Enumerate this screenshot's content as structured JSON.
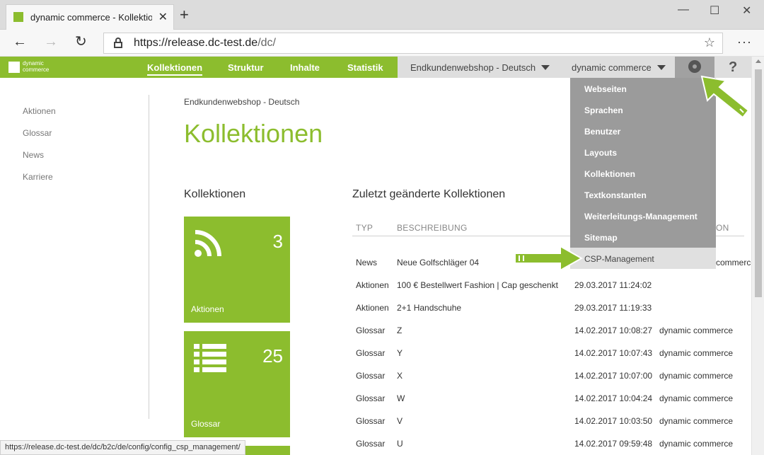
{
  "browser": {
    "tab_title": "dynamic commerce - Kollektione",
    "tab_close": "✕",
    "new_tab": "+",
    "url_host": "https://release.dc-test.de",
    "url_path": "/dc/",
    "star": "☆",
    "more": "···",
    "back": "←",
    "forward": "→",
    "refresh": "↻",
    "minimize": "—",
    "maximize": "☐",
    "close": "✕"
  },
  "cms_bar": {
    "logo_text": "dynamic commerce",
    "menu": [
      "Kollektionen",
      "Struktur",
      "Inhalte",
      "Statistik"
    ],
    "shop_select": "Endkundenwebshop - Deutsch",
    "company_select": "dynamic commerce",
    "help": "?"
  },
  "sidebar": {
    "items": [
      "Aktionen",
      "Glossar",
      "News",
      "Karriere"
    ]
  },
  "main": {
    "breadcrumb": "Endkundenwebshop - Deutsch",
    "title": "Kollektionen",
    "collections_title": "Kollektionen",
    "recent_title": "Zuletzt geänderte Kollektionen",
    "tiles": [
      {
        "count": "3",
        "label": "Aktionen",
        "icon": "rss-icon"
      },
      {
        "count": "25",
        "label": "Glossar",
        "icon": "list-icon"
      }
    ]
  },
  "table": {
    "headers": [
      "TYP",
      "BESCHREIBUNG",
      "ON"
    ],
    "rows": [
      {
        "typ": "News",
        "beschreibung": "Neue Golfschläger 04",
        "datum": "",
        "autor": "commerce"
      },
      {
        "typ": "Aktionen",
        "beschreibung": "100 € Bestellwert Fashion | Cap geschenkt",
        "datum": "29.03.2017 11:24:02",
        "autor": ""
      },
      {
        "typ": "Aktionen",
        "beschreibung": "2+1 Handschuhe",
        "datum": "29.03.2017 11:19:33",
        "autor": ""
      },
      {
        "typ": "Glossar",
        "beschreibung": "Z",
        "datum": "14.02.2017 10:08:27",
        "autor": "dynamic commerce"
      },
      {
        "typ": "Glossar",
        "beschreibung": "Y",
        "datum": "14.02.2017 10:07:43",
        "autor": "dynamic commerce"
      },
      {
        "typ": "Glossar",
        "beschreibung": "X",
        "datum": "14.02.2017 10:07:00",
        "autor": "dynamic commerce"
      },
      {
        "typ": "Glossar",
        "beschreibung": "W",
        "datum": "14.02.2017 10:04:24",
        "autor": "dynamic commerce"
      },
      {
        "typ": "Glossar",
        "beschreibung": "V",
        "datum": "14.02.2017 10:03:50",
        "autor": "dynamic commerce"
      },
      {
        "typ": "Glossar",
        "beschreibung": "U",
        "datum": "14.02.2017 09:59:48",
        "autor": "dynamic commerce"
      }
    ]
  },
  "dropdown": {
    "items": [
      "Webseiten",
      "Sprachen",
      "Benutzer",
      "Layouts",
      "Kollektionen",
      "Textkonstanten",
      "Weiterleitungs-Management",
      "Sitemap",
      "CSP-Management"
    ]
  },
  "status_url": "https://release.dc-test.de/dc/b2c/de/config/config_csp_management/",
  "colors": {
    "brand_green": "#8cbd2e",
    "dropdown_gray": "#9b9b9b",
    "topbar_gray": "#dedede"
  }
}
